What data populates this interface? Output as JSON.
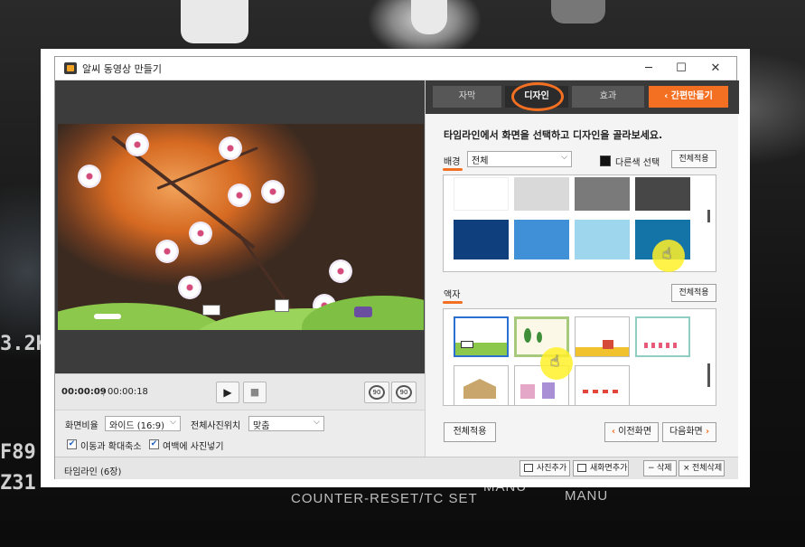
{
  "window": {
    "title": "알씨 동영상 만들기",
    "minimize": "─",
    "maximize": "☐",
    "close": "✕"
  },
  "player": {
    "current_time": "00:00:09",
    "separator": "|",
    "total_time": "00:00:18",
    "rotate_left": "90",
    "rotate_right": "90"
  },
  "options": {
    "ratio_label": "화면비율",
    "ratio_value": "와이드 (16:9)",
    "position_label": "전체사진위치",
    "position_value": "맞춤",
    "check_move_zoom": "이동과 확대축소",
    "check_margin_photo": "여백에 사진넣기"
  },
  "tabs": [
    {
      "label": "자막"
    },
    {
      "label": "디자인"
    },
    {
      "label": "효과"
    },
    {
      "label": "간편만들기",
      "icon": "chevron-left"
    }
  ],
  "design": {
    "instruction": "타임라인에서 화면을 선택하고 디자인을 골라보세요.",
    "background": {
      "label": "배경",
      "dropdown_value": "전체",
      "other_color_label": "다른색 선택",
      "apply_all": "전체적용",
      "swatches": [
        "#ffffff",
        "#d9d9d9",
        "#7a7a7a",
        "#474747",
        "#0f3f7c",
        "#3f90d6",
        "#9ed6ee",
        "#1474a8"
      ]
    },
    "frame": {
      "label": "액자",
      "apply_all": "전체적용"
    },
    "apply_all_bottom": "전체적용",
    "prev_button": "이전화면",
    "next_button": "다음화면"
  },
  "statusbar": {
    "timeline": "타임라인 (6장)",
    "add_photo": "사진추가",
    "add_new_screen": "새화면추가",
    "delete": "삭제",
    "delete_all": "전체삭제"
  },
  "backdrop": {
    "left_text_1": "3.2K",
    "left_text_2": "F89",
    "left_text_3": "Z31",
    "bottom_text": "COUNTER-RESET/TC SET",
    "menu_1": "MANU",
    "menu_2": "MANU"
  },
  "colors": {
    "accent": "#f36f21",
    "tab_bar": "#3a3a3a",
    "selection": "#2b6fd0"
  }
}
